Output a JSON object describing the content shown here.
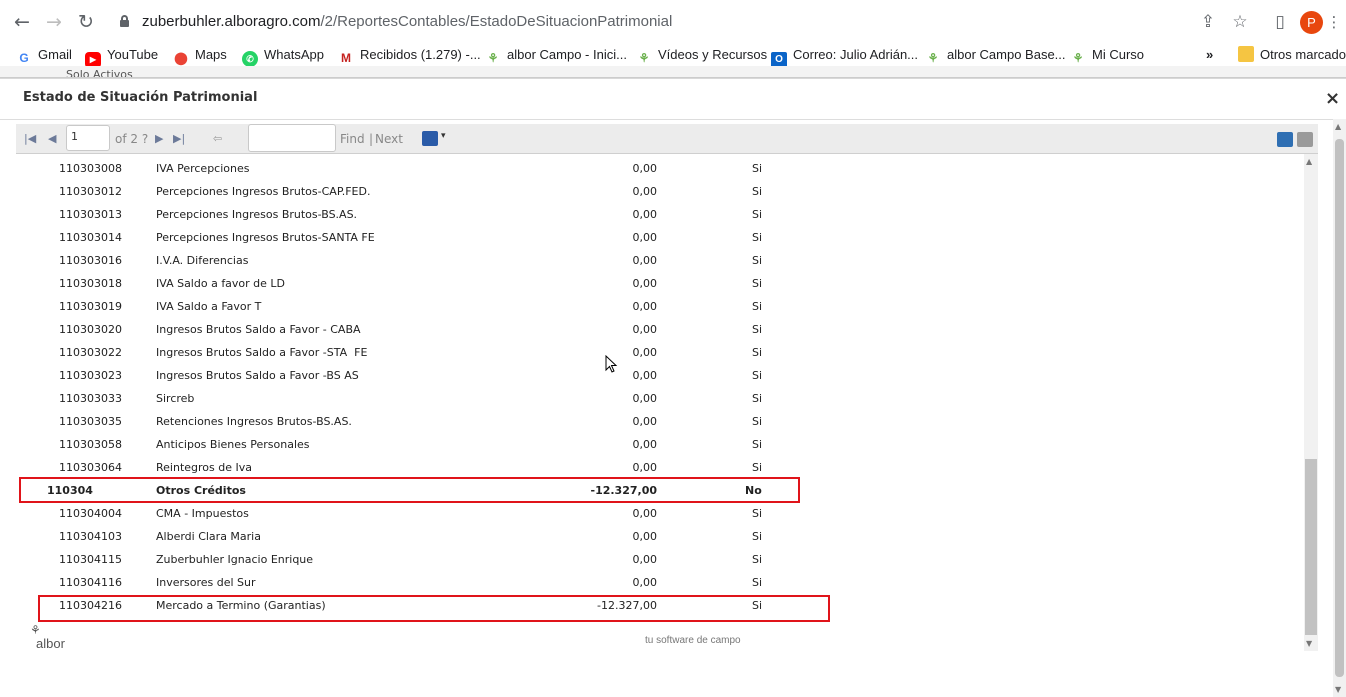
{
  "browser": {
    "url_host": "zuberbuhler.alboragro.com",
    "url_path": "/2/ReportesContables/EstadoDeSituacionPatrimonial",
    "profile_initial": "P"
  },
  "bookmarks": [
    {
      "label": "Gmail",
      "icon": "google-icon"
    },
    {
      "label": "YouTube",
      "icon": "youtube-icon"
    },
    {
      "label": "Maps",
      "icon": "maps-icon"
    },
    {
      "label": "WhatsApp",
      "icon": "whatsapp-icon"
    },
    {
      "label": "Recibidos (1.279) -...",
      "icon": "gmail-icon"
    },
    {
      "label": "albor Campo - Inici...",
      "icon": "albor-icon"
    },
    {
      "label": "Vídeos y Recursos",
      "icon": "albor-icon"
    },
    {
      "label": "Correo: Julio Adrián...",
      "icon": "outlook-icon"
    },
    {
      "label": "albor Campo Base...",
      "icon": "albor-icon"
    },
    {
      "label": "Mi Curso",
      "icon": "albor-icon"
    }
  ],
  "bookmarks_more": "»",
  "bookmarks_other": "Otros marcadores",
  "behind_text": "Solo Activos",
  "modal": {
    "title": "Estado de Situación Patrimonial",
    "close": "×"
  },
  "toolbar": {
    "page_value": "1",
    "page_of": "of 2 ?",
    "find_label": "Find",
    "separator": "|",
    "next_label": "Next",
    "search_value": ""
  },
  "rows": [
    {
      "code": "110303008",
      "desc": "IVA Percepciones",
      "amount": "0,00",
      "flag": "Si",
      "bold": false
    },
    {
      "code": "110303012",
      "desc": "Percepciones Ingresos Brutos-CAP.FED.",
      "amount": "0,00",
      "flag": "Si",
      "bold": false
    },
    {
      "code": "110303013",
      "desc": "Percepciones Ingresos Brutos-BS.AS.",
      "amount": "0,00",
      "flag": "Si",
      "bold": false
    },
    {
      "code": "110303014",
      "desc": "Percepciones Ingresos Brutos-SANTA FE",
      "amount": "0,00",
      "flag": "Si",
      "bold": false
    },
    {
      "code": "110303016",
      "desc": "I.V.A. Diferencias",
      "amount": "0,00",
      "flag": "Si",
      "bold": false
    },
    {
      "code": "110303018",
      "desc": "IVA Saldo a favor de LD",
      "amount": "0,00",
      "flag": "Si",
      "bold": false
    },
    {
      "code": "110303019",
      "desc": "IVA Saldo a Favor T",
      "amount": "0,00",
      "flag": "Si",
      "bold": false
    },
    {
      "code": "110303020",
      "desc": "Ingresos Brutos Saldo a Favor - CABA",
      "amount": "0,00",
      "flag": "Si",
      "bold": false
    },
    {
      "code": "110303022",
      "desc": "Ingresos Brutos Saldo a Favor -STA  FE",
      "amount": "0,00",
      "flag": "Si",
      "bold": false
    },
    {
      "code": "110303023",
      "desc": "Ingresos Brutos Saldo a Favor -BS AS",
      "amount": "0,00",
      "flag": "Si",
      "bold": false
    },
    {
      "code": "110303033",
      "desc": "Sircreb",
      "amount": "0,00",
      "flag": "Si",
      "bold": false
    },
    {
      "code": "110303035",
      "desc": "Retenciones Ingresos Brutos-BS.AS.",
      "amount": "0,00",
      "flag": "Si",
      "bold": false
    },
    {
      "code": "110303058",
      "desc": "Anticipos Bienes Personales",
      "amount": "0,00",
      "flag": "Si",
      "bold": false
    },
    {
      "code": "110303064",
      "desc": "Reintegros de Iva",
      "amount": "0,00",
      "flag": "Si",
      "bold": false
    },
    {
      "code": "110304",
      "desc": "Otros Créditos",
      "amount": "-12.327,00",
      "flag": "No",
      "bold": true
    },
    {
      "code": "110304004",
      "desc": "CMA - Impuestos",
      "amount": "0,00",
      "flag": "Si",
      "bold": false
    },
    {
      "code": "110304103",
      "desc": "Alberdi Clara Maria",
      "amount": "0,00",
      "flag": "Si",
      "bold": false
    },
    {
      "code": "110304115",
      "desc": "Zuberbuhler Ignacio Enrique",
      "amount": "0,00",
      "flag": "Si",
      "bold": false
    },
    {
      "code": "110304116",
      "desc": "Inversores del Sur",
      "amount": "0,00",
      "flag": "Si",
      "bold": false
    },
    {
      "code": "110304216",
      "desc": "Mercado a Termino (Garantias)",
      "amount": "-12.327,00",
      "flag": "Si",
      "bold": false
    }
  ],
  "footer": {
    "logo_text": "albor",
    "tagline": "tu software de campo"
  },
  "colors": {
    "highlight": "#e0141a",
    "toolbar_bg": "#ececec"
  }
}
